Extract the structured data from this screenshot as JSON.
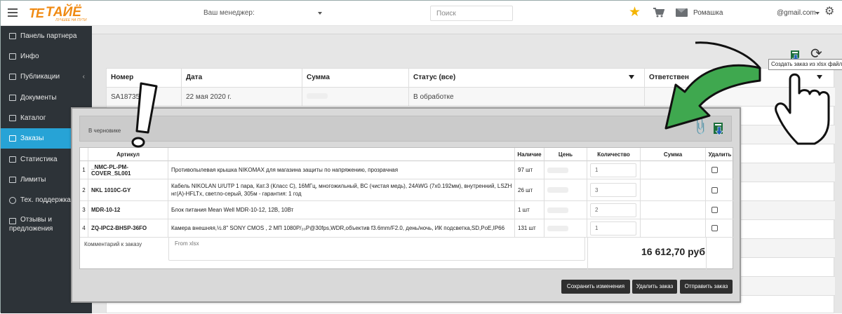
{
  "topbar": {
    "logo_text": "ТАЙЁ",
    "logo_tagline": "ЛУЧШЕЕ НА ПУТИ",
    "manager_label": "Ваш менеджер:",
    "search_placeholder": "Поиск",
    "company": "Ромашка",
    "account": "@gmail.com",
    "star_icon": "star-icon",
    "cart_icon": "cart-icon",
    "mail_icon": "mail-icon",
    "settings_icon": "cogs-icon",
    "accent_star": "#f4b400",
    "brand_color": "#f08a12"
  },
  "sidebar": {
    "items": [
      {
        "label": "Панель партнера",
        "icon": "panel-icon"
      },
      {
        "label": "Инфо",
        "icon": "info-card-icon"
      },
      {
        "label": "Публикации",
        "icon": "book-icon",
        "caret": "‹"
      },
      {
        "label": "Документы",
        "icon": "document-icon"
      },
      {
        "label": "Каталог",
        "icon": "catalog-icon"
      },
      {
        "label": "Заказы",
        "icon": "orders-icon",
        "active": true
      },
      {
        "label": "Статистика",
        "icon": "statistics-icon"
      },
      {
        "label": "Лимиты",
        "icon": "limits-icon"
      },
      {
        "label": "Тех. поддержка",
        "icon": "help-circle-icon"
      },
      {
        "label": "Отзывы и предложения",
        "icon": "feedback-icon"
      }
    ],
    "active_color": "#27a3d6"
  },
  "orders_table": {
    "headers": [
      "Номер",
      "Дата",
      "Сумма",
      "Статус (все)",
      "Ответствен"
    ],
    "rows": [
      {
        "number": "SA187356",
        "date": "22 мая 2020 г.",
        "sum": "",
        "status": "В обработке"
      }
    ]
  },
  "toolbar": {
    "tooltip": "Создать заказ из xlsx файла"
  },
  "modal": {
    "status": "В черновике",
    "columns": [
      "Артикул",
      "",
      "Наличие",
      "Цень",
      "Количество",
      "Сумма",
      "Удалить"
    ],
    "rows": [
      {
        "n": "1",
        "sku": "_NMC-PL-PM-COVER_SL001",
        "name": "Противопылевая крышка NIKOMAX для магазина защиты по напряжению, прозрачная",
        "stock": "97 шт",
        "qty": "1"
      },
      {
        "n": "2",
        "sku": "NKL 1010C-GY",
        "name": "Кабель NIKOLAN U/UTP 1 пара, Кат.3 (Класс C), 16МГц, многожильный, BC (чистая медь), 24AWG (7x0.192мм), внутренний, LSZH нг(A)-HFLTx, светло-серый, 305м - гарантия: 1 год",
        "stock": "26 шт",
        "qty": "3"
      },
      {
        "n": "3",
        "sku": "MDR-10-12",
        "name": "Блок питания Mean Well MDR-10-12, 12В, 10Вт",
        "stock": "1 шт",
        "qty": "2"
      },
      {
        "n": "4",
        "sku": "ZQ-IPC2-BHSP-36FO",
        "name": "Камера внешняя,½.8\" SONY CMOS , 2 МП 1080P/₂₀P@30fps,WDR,объектив f3.6mm/F2.0, день/ночь, ИК подсветка,SD,PoE,IP66",
        "stock": "131 шт",
        "qty": "1"
      }
    ],
    "comment_label": "Комментарий к заказу",
    "comment_value": "From xlsx",
    "total": "16 612,70 руб",
    "buttons": {
      "save": "Сохранить изменения",
      "delete": "Удалить заказ",
      "send": "Отправить заказ"
    }
  }
}
